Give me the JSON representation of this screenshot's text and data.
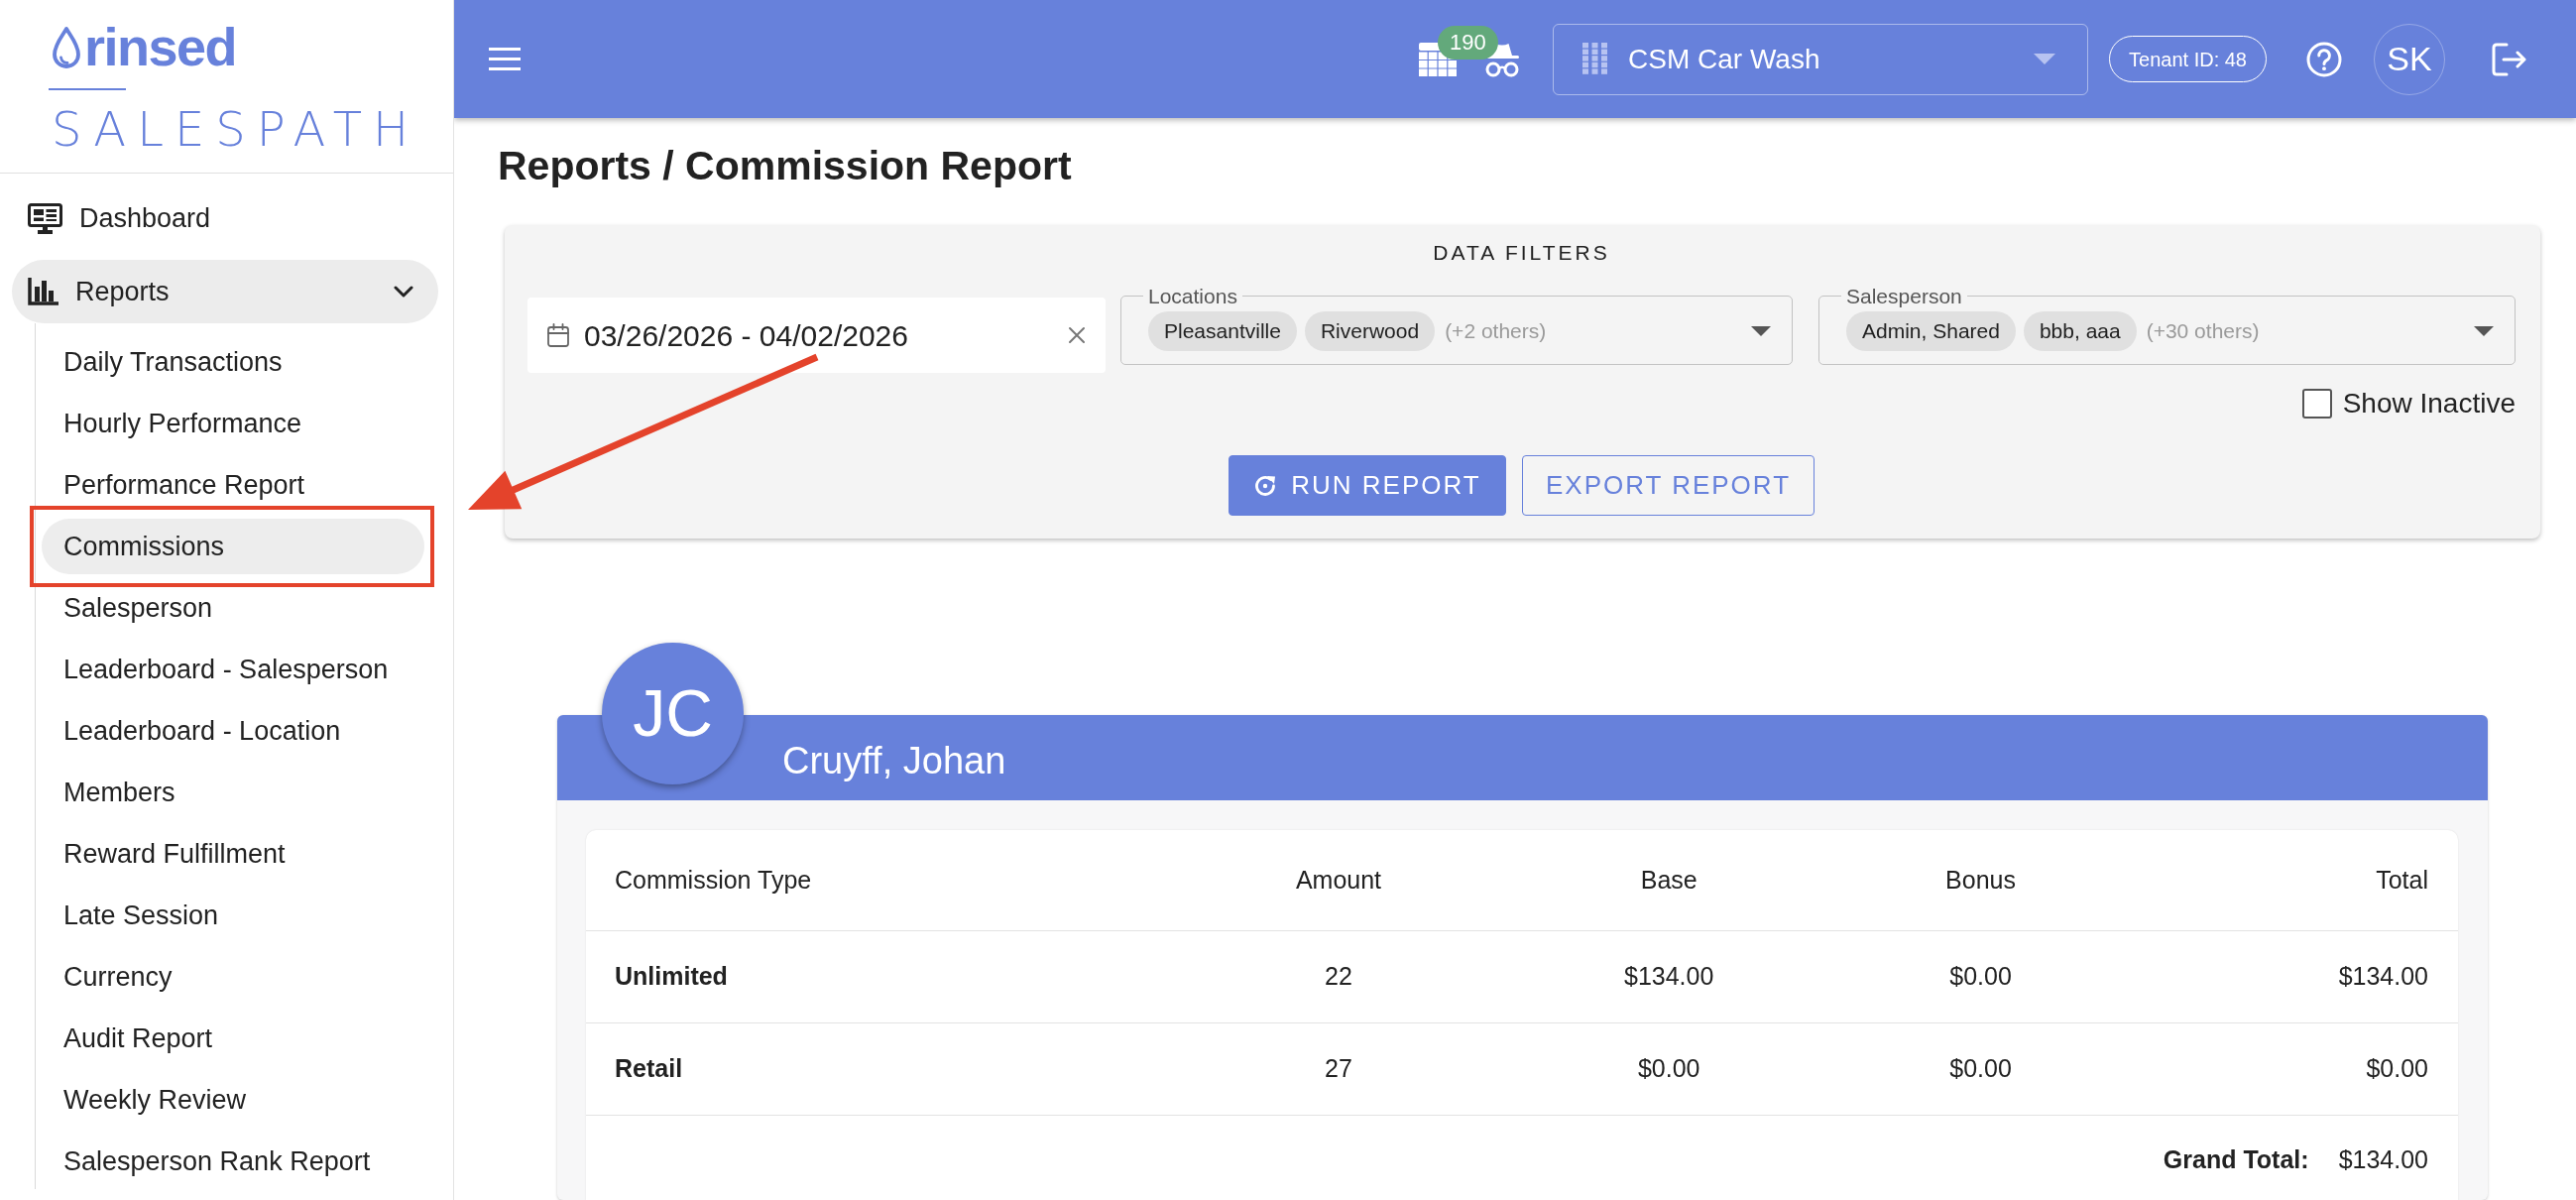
{
  "sidebar": {
    "logo": {
      "brand": "rinsed",
      "product": "SALESPATH"
    },
    "items": [
      {
        "label": "Dashboard",
        "selected": false
      },
      {
        "label": "Reports",
        "selected": true,
        "expanded": true,
        "children": [
          {
            "label": "Daily Transactions",
            "selected": false
          },
          {
            "label": "Hourly Performance",
            "selected": false
          },
          {
            "label": "Performance Report",
            "selected": false
          },
          {
            "label": "Commissions",
            "selected": true
          },
          {
            "label": "Salesperson",
            "selected": false
          },
          {
            "label": "Leaderboard - Salesperson",
            "selected": false
          },
          {
            "label": "Leaderboard - Location",
            "selected": false
          },
          {
            "label": "Members",
            "selected": false
          },
          {
            "label": "Reward Fulfillment",
            "selected": false
          },
          {
            "label": "Late Session",
            "selected": false
          },
          {
            "label": "Currency",
            "selected": false
          },
          {
            "label": "Audit Report",
            "selected": false
          },
          {
            "label": "Weekly Review",
            "selected": false
          },
          {
            "label": "Salesperson Rank Report",
            "selected": false
          }
        ]
      }
    ]
  },
  "topbar": {
    "notification_count": "190",
    "location": "CSM Car Wash",
    "tenant": "Tenant ID: 48",
    "user_initials": "SK"
  },
  "page_title": "Reports / Commission Report",
  "filters": {
    "title": "DATA FILTERS",
    "date_range": {
      "value": "03/26/2026 - 04/02/2026"
    },
    "locations": {
      "label": "Locations",
      "chips": [
        "Pleasantville",
        "Riverwood"
      ],
      "more": "(+2 others)"
    },
    "salesperson": {
      "label": "Salesperson",
      "chips": [
        "Admin, Shared",
        "bbb, aaa"
      ],
      "more": "(+30 others)"
    },
    "show_inactive": {
      "label": "Show Inactive",
      "checked": false
    },
    "buttons": [
      {
        "label": "RUN REPORT",
        "kind": "run"
      },
      {
        "label": "EXPORT REPORT",
        "kind": "export"
      }
    ]
  },
  "report": {
    "initials": "JC",
    "name": "Cruyff, Johan",
    "columns": [
      "Commission Type",
      "Amount",
      "Base",
      "Bonus",
      "Total"
    ],
    "rows": [
      [
        "Unlimited",
        "22",
        "$134.00",
        "$0.00",
        "$134.00"
      ],
      [
        "Retail",
        "27",
        "$0.00",
        "$0.00",
        "$0.00"
      ]
    ],
    "grand_total": {
      "label": "Grand Total:",
      "value": "$134.00"
    }
  },
  "annotations": {
    "highlight_box": true,
    "arrow": true
  }
}
